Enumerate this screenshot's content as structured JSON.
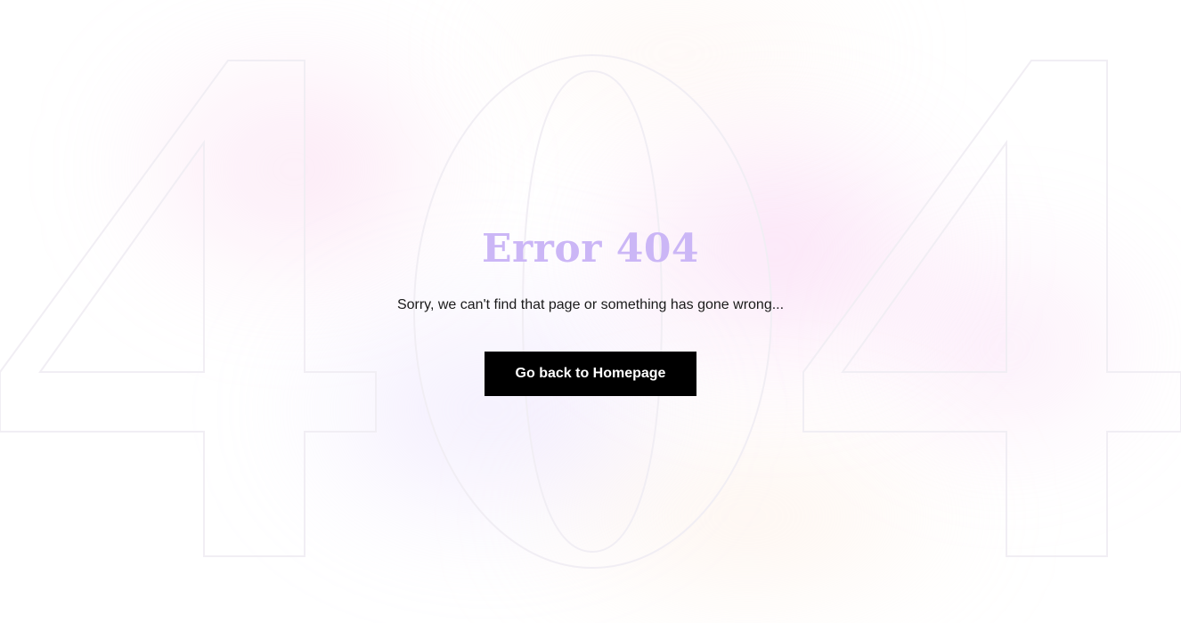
{
  "error": {
    "title": "Error 404",
    "message": "Sorry, we can't find that page or something has gone wrong...",
    "home_button_label": "Go back to Homepage"
  },
  "background": {
    "watermark": "404",
    "title_color": "#cbb6f6",
    "button_color": "#000000"
  }
}
